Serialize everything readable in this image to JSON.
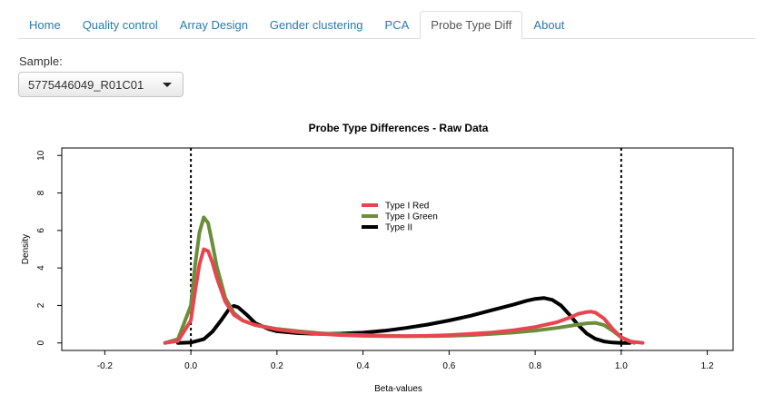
{
  "tabs": [
    {
      "label": "Home",
      "active": false
    },
    {
      "label": "Quality control",
      "active": false
    },
    {
      "label": "Array Design",
      "active": false
    },
    {
      "label": "Gender clustering",
      "active": false
    },
    {
      "label": "PCA",
      "active": false
    },
    {
      "label": "Probe Type Diff",
      "active": true
    },
    {
      "label": "About",
      "active": false
    }
  ],
  "sample": {
    "label": "Sample:",
    "selected": "5775446049_R01C01",
    "dropdown_icon": "caret-down-icon"
  },
  "colors": {
    "tab_link": "#2a7ab0",
    "type_i_red": "#e8454f",
    "type_i_green": "#6b8e3a",
    "type_ii": "#000000"
  },
  "chart_data": {
    "type": "line",
    "title": "Probe Type Differences - Raw Data",
    "xlabel": "Beta-values",
    "ylabel": "Density",
    "xlim": [
      -0.3,
      1.26
    ],
    "ylim": [
      -0.4,
      10.4
    ],
    "xticks": [
      -0.2,
      0.0,
      0.2,
      0.4,
      0.6,
      0.8,
      1.0,
      1.2
    ],
    "xtick_labels": [
      "-0.2",
      "0.0",
      "0.2",
      "0.4",
      "0.6",
      "0.8",
      "1.0",
      "1.2"
    ],
    "yticks": [
      0,
      2,
      4,
      6,
      8,
      10
    ],
    "ytick_labels": [
      "0",
      "2",
      "4",
      "6",
      "8",
      "10"
    ],
    "vlines": [
      0,
      1
    ],
    "legend_position": "top-center",
    "series": [
      {
        "name": "Type I Red",
        "color": "#e8454f",
        "x": [
          -0.06,
          -0.03,
          0.0,
          0.01,
          0.02,
          0.03,
          0.04,
          0.05,
          0.06,
          0.08,
          0.1,
          0.12,
          0.15,
          0.2,
          0.25,
          0.3,
          0.35,
          0.4,
          0.45,
          0.5,
          0.55,
          0.6,
          0.65,
          0.7,
          0.75,
          0.8,
          0.85,
          0.88,
          0.9,
          0.92,
          0.93,
          0.94,
          0.96,
          0.98,
          1.0,
          1.02,
          1.05
        ],
        "y": [
          0.0,
          0.1,
          1.2,
          2.8,
          4.2,
          5.0,
          4.9,
          4.3,
          3.5,
          2.2,
          1.5,
          1.2,
          0.95,
          0.72,
          0.58,
          0.48,
          0.42,
          0.38,
          0.36,
          0.36,
          0.38,
          0.42,
          0.48,
          0.56,
          0.68,
          0.85,
          1.1,
          1.35,
          1.55,
          1.65,
          1.67,
          1.62,
          1.3,
          0.75,
          0.3,
          0.08,
          0.0
        ]
      },
      {
        "name": "Type I Green",
        "color": "#6b8e3a",
        "x": [
          -0.06,
          -0.03,
          0.0,
          0.01,
          0.02,
          0.03,
          0.04,
          0.05,
          0.06,
          0.08,
          0.1,
          0.12,
          0.15,
          0.2,
          0.25,
          0.3,
          0.35,
          0.4,
          0.45,
          0.5,
          0.55,
          0.6,
          0.65,
          0.7,
          0.75,
          0.8,
          0.85,
          0.9,
          0.92,
          0.94,
          0.96,
          0.98,
          1.0,
          1.03
        ],
        "y": [
          0.0,
          0.2,
          2.0,
          4.2,
          5.9,
          6.7,
          6.4,
          5.3,
          4.1,
          2.4,
          1.6,
          1.2,
          0.95,
          0.75,
          0.62,
          0.52,
          0.46,
          0.42,
          0.38,
          0.36,
          0.36,
          0.38,
          0.42,
          0.48,
          0.56,
          0.66,
          0.8,
          0.98,
          1.05,
          1.07,
          0.95,
          0.65,
          0.3,
          0.0
        ]
      },
      {
        "name": "Type II",
        "color": "#000000",
        "x": [
          -0.03,
          0.0,
          0.03,
          0.05,
          0.07,
          0.09,
          0.1,
          0.11,
          0.13,
          0.15,
          0.18,
          0.2,
          0.25,
          0.3,
          0.35,
          0.4,
          0.45,
          0.5,
          0.55,
          0.6,
          0.65,
          0.7,
          0.75,
          0.78,
          0.8,
          0.82,
          0.84,
          0.86,
          0.88,
          0.9,
          0.92,
          0.94,
          0.96,
          0.98,
          1.0,
          1.02
        ],
        "y": [
          0.0,
          0.02,
          0.2,
          0.6,
          1.2,
          1.85,
          1.98,
          1.9,
          1.5,
          1.05,
          0.75,
          0.62,
          0.52,
          0.48,
          0.5,
          0.55,
          0.65,
          0.8,
          0.98,
          1.2,
          1.45,
          1.75,
          2.05,
          2.25,
          2.35,
          2.4,
          2.3,
          2.0,
          1.5,
          0.95,
          0.5,
          0.22,
          0.08,
          0.02,
          0.0,
          0.0
        ]
      }
    ]
  }
}
